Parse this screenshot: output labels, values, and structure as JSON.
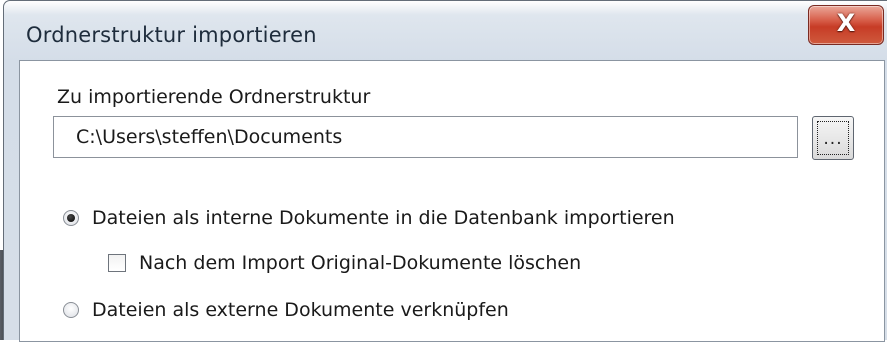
{
  "dialog": {
    "title": "Ordnerstruktur importieren",
    "close_label": "X"
  },
  "folder": {
    "label": "Zu importierende Ordnerstruktur",
    "path_value": "C:\\Users\\steffen\\Documents",
    "browse_label": "..."
  },
  "options": {
    "import_internal": {
      "label": "Dateien als interne Dokumente in die Datenbank importieren",
      "selected": true
    },
    "delete_originals": {
      "label": "Nach dem Import Original-Dokumente löschen",
      "checked": false
    },
    "link_external": {
      "label": "Dateien als externe Dokumente verknüpfen",
      "selected": false
    }
  }
}
